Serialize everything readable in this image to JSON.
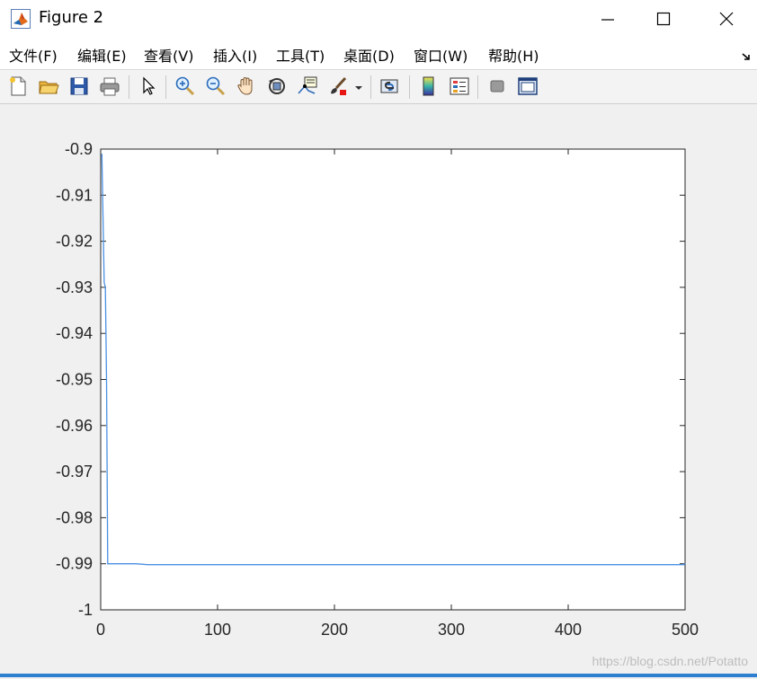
{
  "window": {
    "title": "Figure 2",
    "controls": [
      "minimize",
      "maximize",
      "close"
    ]
  },
  "menubar": {
    "items": [
      {
        "label": "文件(F)"
      },
      {
        "label": "编辑(E)"
      },
      {
        "label": "查看(V)"
      },
      {
        "label": "插入(I)"
      },
      {
        "label": "工具(T)"
      },
      {
        "label": "桌面(D)"
      },
      {
        "label": "窗口(W)"
      },
      {
        "label": "帮助(H)"
      }
    ]
  },
  "toolbar": {
    "buttons": [
      "new-figure-icon",
      "open-file-icon",
      "save-icon",
      "print-icon",
      "pointer-icon",
      "zoom-in-icon",
      "zoom-out-icon",
      "pan-hand-icon",
      "rotate-3d-icon",
      "data-cursor-icon",
      "brush-icon",
      "brush-dropdown-icon",
      "link-plot-icon",
      "colorbar-icon",
      "legend-icon",
      "hide-plot-tools-icon",
      "show-plot-tools-icon"
    ]
  },
  "watermark": "https://blog.csdn.net/Potatto",
  "colors": {
    "line": "#4a90e2",
    "axes_bg": "#ffffff",
    "figure_bg": "#f0f0f0",
    "title_bar": "#ffffff"
  },
  "chart_data": {
    "type": "line",
    "title": "",
    "xlabel": "",
    "ylabel": "",
    "xlim": [
      0,
      500
    ],
    "ylim": [
      -1,
      -0.9
    ],
    "xticks": [
      0,
      100,
      200,
      300,
      400,
      500
    ],
    "yticks": [
      -0.9,
      -0.91,
      -0.92,
      -0.93,
      -0.94,
      -0.95,
      -0.96,
      -0.97,
      -0.98,
      -0.99,
      -1
    ],
    "ytick_labels": [
      "-0.9",
      "-0.91",
      "-0.92",
      "-0.93",
      "-0.94",
      "-0.95",
      "-0.96",
      "-0.97",
      "-0.98",
      "-0.99",
      "-1"
    ],
    "xtick_labels": [
      "0",
      "100",
      "200",
      "300",
      "400",
      "500"
    ],
    "grid": false,
    "series": [
      {
        "x": [
          1,
          2,
          3,
          4,
          5,
          6,
          10,
          20,
          30,
          40,
          50,
          100,
          200,
          300,
          400,
          499,
          500
        ],
        "y": [
          -0.901,
          -0.915,
          -0.929,
          -0.93,
          -0.95,
          -0.99,
          -0.99,
          -0.99,
          -0.99,
          -0.9902,
          -0.9902,
          -0.9902,
          -0.9902,
          -0.9902,
          -0.9902,
          -0.9902,
          -0.9899
        ]
      }
    ]
  }
}
